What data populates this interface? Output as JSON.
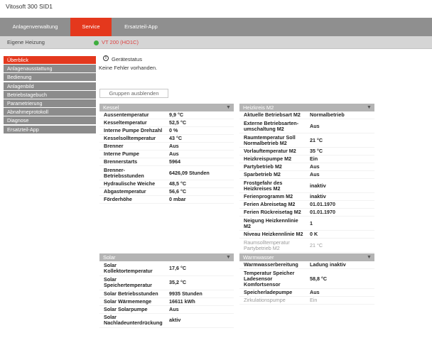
{
  "app_title": "Vitosoft 300 SID1",
  "topnav": {
    "items": [
      {
        "label": "Anlagenverwaltung",
        "active": false
      },
      {
        "label": "Service",
        "active": true
      },
      {
        "label": "Ersatzteil-App",
        "active": false
      }
    ]
  },
  "subbar": {
    "heating_label": "Eigene Heizung",
    "device_label": "VT 200 (HO1C)",
    "device_status_color": "#3fae3f"
  },
  "sidebar": {
    "items": [
      {
        "label": "Überblick",
        "active": true
      },
      {
        "label": "Anlagenausstattung"
      },
      {
        "label": "Bedienung"
      },
      {
        "label": "Anlagenbild"
      },
      {
        "label": "Betriebstagebuch"
      },
      {
        "label": "Parametrierung"
      },
      {
        "label": "Abnahmeprotokoll"
      },
      {
        "label": "Diagnose"
      },
      {
        "label": "Ersatzteil-App"
      }
    ]
  },
  "status": {
    "icon_glyph": "!",
    "title": "Gerätestatus",
    "text": "Keine Fehler vorhanden."
  },
  "hide_groups_label": "Gruppen ausblenden",
  "colors": {
    "accent": "#e4381d",
    "nav_gray": "#8f8f8f",
    "panel_header": "#b4b4b4"
  },
  "panels": {
    "kessel": {
      "title": "Kessel",
      "rows": [
        {
          "label": "Aussentemperatur",
          "value": "9,9 °C"
        },
        {
          "label": "Kesseltemperatur",
          "value": "52,5 °C"
        },
        {
          "label": "Interne Pumpe Drehzahl",
          "value": "0 %"
        },
        {
          "label": "Kesselsolltemperatur",
          "value": "43 °C"
        },
        {
          "label": "Brenner",
          "value": "Aus"
        },
        {
          "label": "Interne Pumpe",
          "value": "Aus"
        },
        {
          "label": "Brennerstarts",
          "value": "5964"
        },
        {
          "label": "Brenner-Betriebsstunden",
          "value": "6426,09 Stunden"
        },
        {
          "label": "Hydraulische Weiche",
          "value": "48,5 °C"
        },
        {
          "label": "Abgastemperatur",
          "value": "56,6 °C"
        },
        {
          "label": "Förderhöhe",
          "value": "0 mbar"
        }
      ]
    },
    "heizkreis": {
      "title": "Heizkreis M2",
      "rows": [
        {
          "label": "Aktuelle Betriebsart M2",
          "value": "Normalbetrieb"
        },
        {
          "label": "Externe Betriebsarten-umschaltung M2",
          "value": "Aus"
        },
        {
          "label": "Raumtemperatur Soll Normalbetrieb M2",
          "value": "21 °C"
        },
        {
          "label": "Vorlauftemperatur M2",
          "value": "35 °C"
        },
        {
          "label": "Heizkreispumpe M2",
          "value": "Ein"
        },
        {
          "label": "Partybetrieb M2",
          "value": "Aus"
        },
        {
          "label": "Sparbetrieb M2",
          "value": "Aus"
        },
        {
          "label": "Frostgefahr des Heizkreises M2",
          "value": "inaktiv"
        },
        {
          "label": "Ferienprogramm M2",
          "value": "inaktiv"
        },
        {
          "label": "Ferien Abreisetag M2",
          "value": "01.01.1970"
        },
        {
          "label": "Ferien Rückreisetag M2",
          "value": "01.01.1970"
        },
        {
          "label": "Neigung Heizkennlinie M2",
          "value": "1"
        },
        {
          "label": "Niveau Heizkennlinie M2",
          "value": "0 K"
        },
        {
          "label": "Raumsolltemperatur Partybetrieb M2",
          "value": "21 °C",
          "muted": true
        }
      ]
    },
    "solar": {
      "title": "Solar",
      "rows": [
        {
          "label": "Solar Kollektortemperatur",
          "value": "17,6 °C"
        },
        {
          "label": "Solar Speichertemperatur",
          "value": "35,2 °C"
        },
        {
          "label": "Solar Betriebsstunden",
          "value": "9935 Stunden"
        },
        {
          "label": "Solar Wärmemenge",
          "value": "16611 kWh"
        },
        {
          "label": "Solar Solarpumpe",
          "value": "Aus"
        },
        {
          "label": "Solar Nachladeunterdrückung",
          "value": "aktiv"
        }
      ]
    },
    "warmwasser": {
      "title": "Warmwasser",
      "rows": [
        {
          "label": "Warmwasserbereitung",
          "value": "Ladung inaktiv"
        },
        {
          "label": "Temperatur Speicher Ladesensor Komfortsensor",
          "value": "58,8 °C"
        },
        {
          "label": "Speicherladepumpe",
          "value": "Aus"
        },
        {
          "label": "Zirkulationspumpe",
          "value": "Ein",
          "muted": true
        }
      ]
    }
  }
}
